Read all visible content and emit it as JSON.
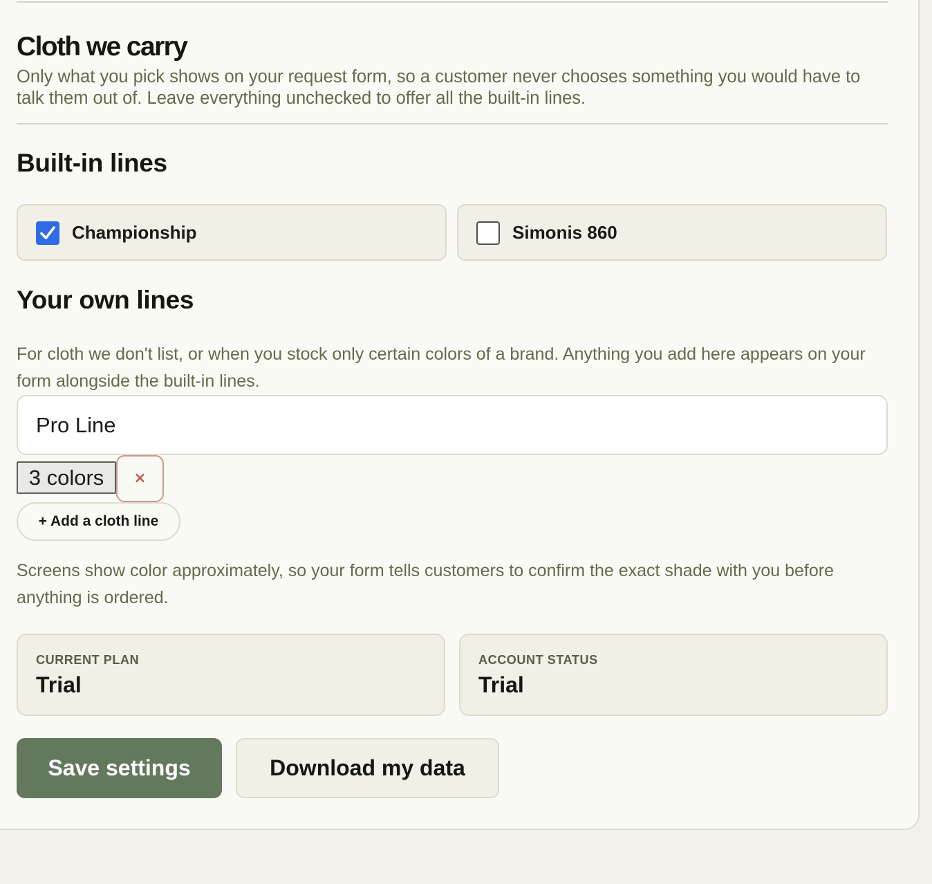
{
  "cloth_section": {
    "title": "Cloth we carry",
    "description": "Only what you pick shows on your request form, so a customer never chooses something you would have to talk them out of. Leave everything unchecked to offer all the built-in lines."
  },
  "builtin_lines": {
    "heading": "Built-in lines",
    "items": [
      {
        "label": "Championship",
        "checked": true
      },
      {
        "label": "Simonis 860",
        "checked": false
      }
    ]
  },
  "own_lines": {
    "heading": "Your own lines",
    "help": "For cloth we don't list, or when you stock only certain colors of a brand. Anything you add here appears on your form alongside the built-in lines.",
    "entries": [
      {
        "name_value": "Pro Line",
        "colors_label": "3 colors",
        "remove_icon": "×"
      }
    ],
    "add_label": "+ Add a cloth line",
    "note": "Screens show color approximately, so your form tells customers to confirm the exact shade with you before anything is ordered."
  },
  "plan": {
    "label": "Current plan",
    "value": "Trial"
  },
  "status": {
    "label": "Account status",
    "value": "Trial"
  },
  "actions": {
    "save_label": "Save settings",
    "download_label": "Download my data"
  },
  "colors": {
    "accent_check": "#2f6be4",
    "save_button": "#63785d",
    "remove_icon": "#c25c4e"
  }
}
